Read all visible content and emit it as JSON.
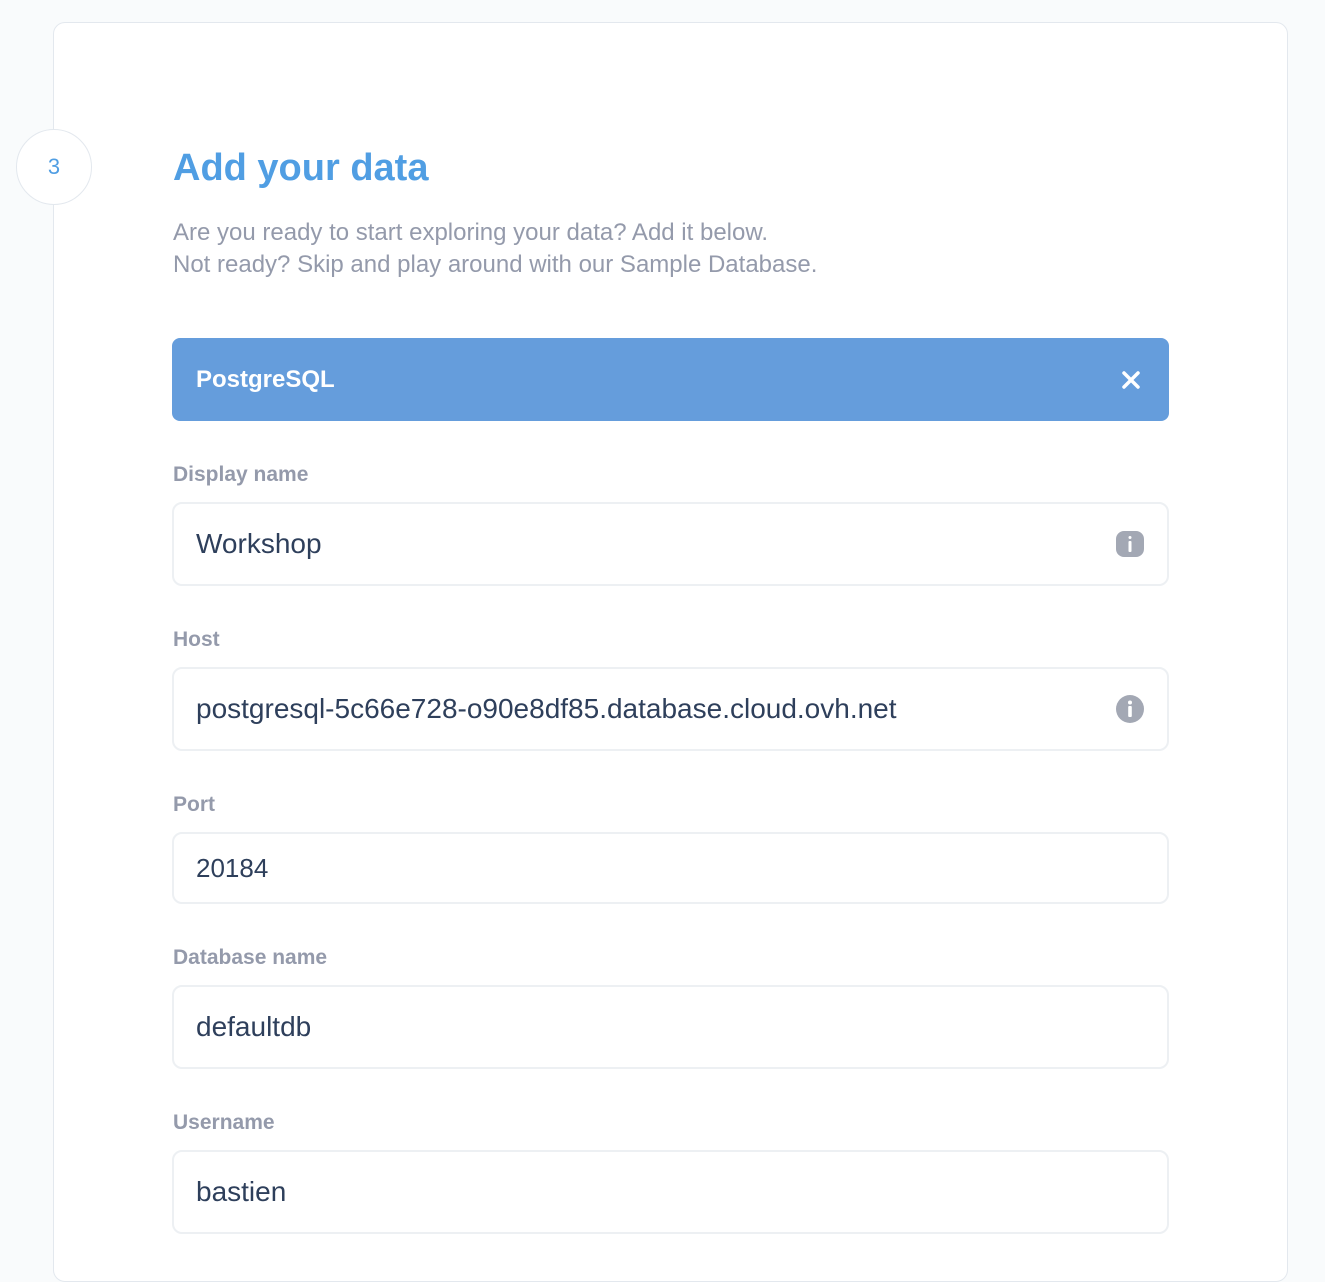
{
  "step": {
    "number": "3"
  },
  "header": {
    "title": "Add your data",
    "subtitle_line1": "Are you ready to start exploring your data? Add it below.",
    "subtitle_line2": "Not ready? Skip and play around with our Sample Database."
  },
  "engine": {
    "name": "PostgreSQL",
    "close_icon": "close-icon"
  },
  "fields": {
    "display_name": {
      "label": "Display name",
      "value": "Workshop",
      "icon": "info-icon"
    },
    "host": {
      "label": "Host",
      "value": "postgresql-5c66e728-o90e8df85.database.cloud.ovh.net",
      "icon": "info-icon"
    },
    "port": {
      "label": "Port",
      "value": "20184"
    },
    "database_name": {
      "label": "Database name",
      "value": "defaultdb"
    },
    "username": {
      "label": "Username",
      "value": "bastien"
    }
  },
  "colors": {
    "accent": "#509ee3",
    "engine_bar": "#659ddc",
    "label": "#949aab",
    "value_text": "#2e3f5b"
  }
}
